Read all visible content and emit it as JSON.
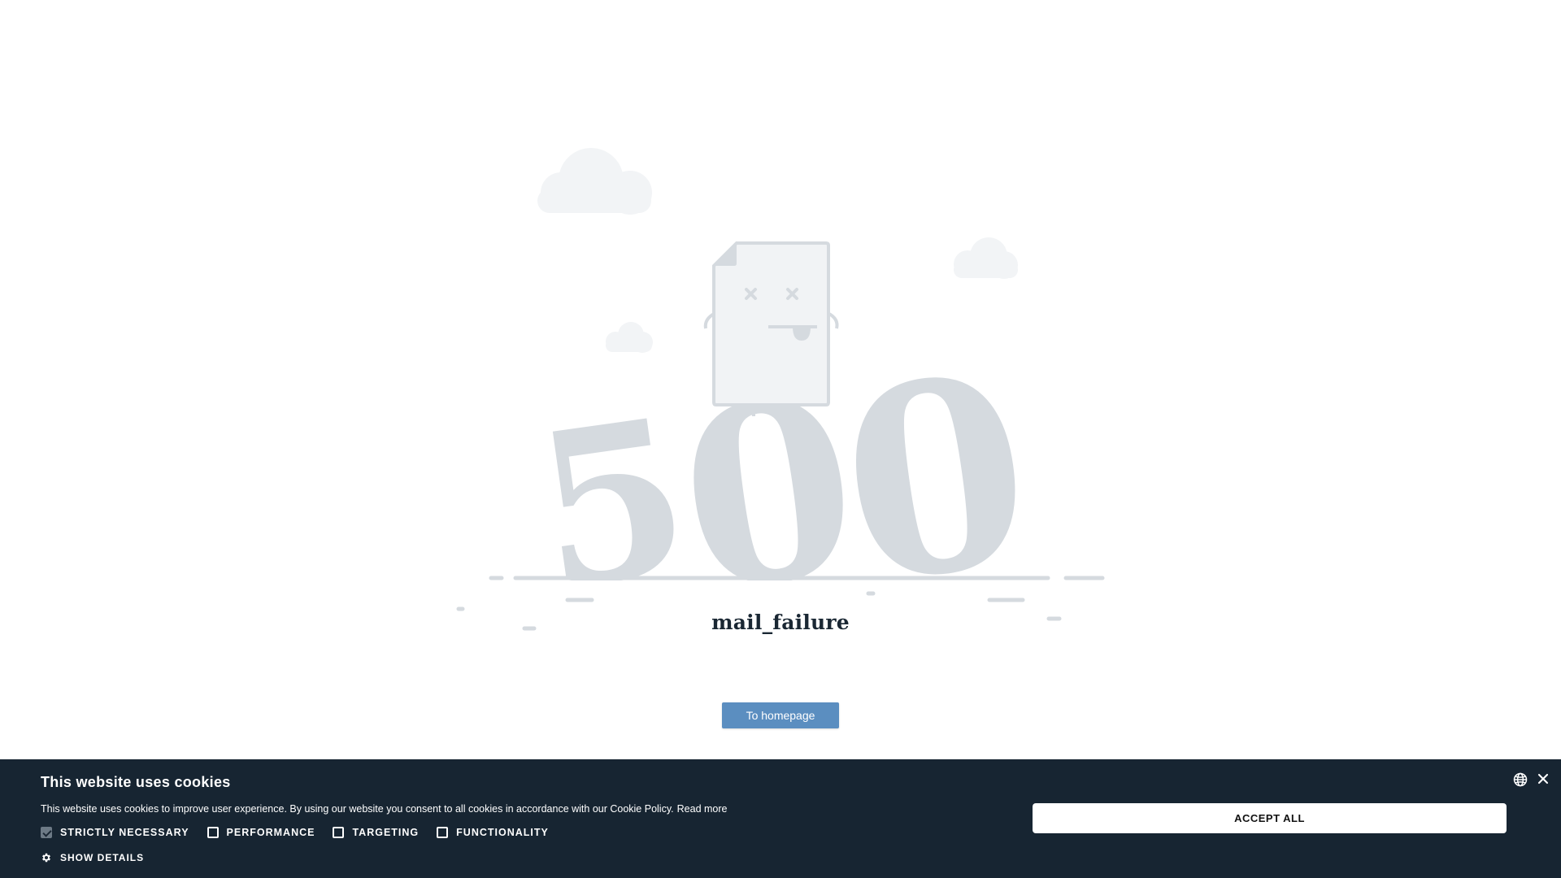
{
  "illustration": {
    "big_number": "500",
    "colors": {
      "number": "#d5dadf",
      "cloud": "#f2f4f6",
      "paper_fill": "#f1f3f5",
      "paper_stroke": "#d5dadf"
    }
  },
  "error": {
    "code_text": "mail_failure"
  },
  "actions": {
    "home_label": "To homepage",
    "home_color": "#5b8ec0"
  },
  "cookie_banner": {
    "title": "This website uses cookies",
    "text": "This website uses cookies to improve user experience. By using our website you consent to all cookies in accordance with our Cookie Policy.",
    "read_more": "Read more",
    "options": [
      {
        "label": "STRICTLY NECESSARY",
        "checked": true
      },
      {
        "label": "PERFORMANCE",
        "checked": false
      },
      {
        "label": "TARGETING",
        "checked": false
      },
      {
        "label": "FUNCTIONALITY",
        "checked": false
      }
    ],
    "show_details": "SHOW DETAILS",
    "accept_all": "ACCEPT ALL",
    "background_color": "#172532",
    "icons": [
      "globe-icon",
      "close-icon",
      "gear-icon"
    ]
  }
}
